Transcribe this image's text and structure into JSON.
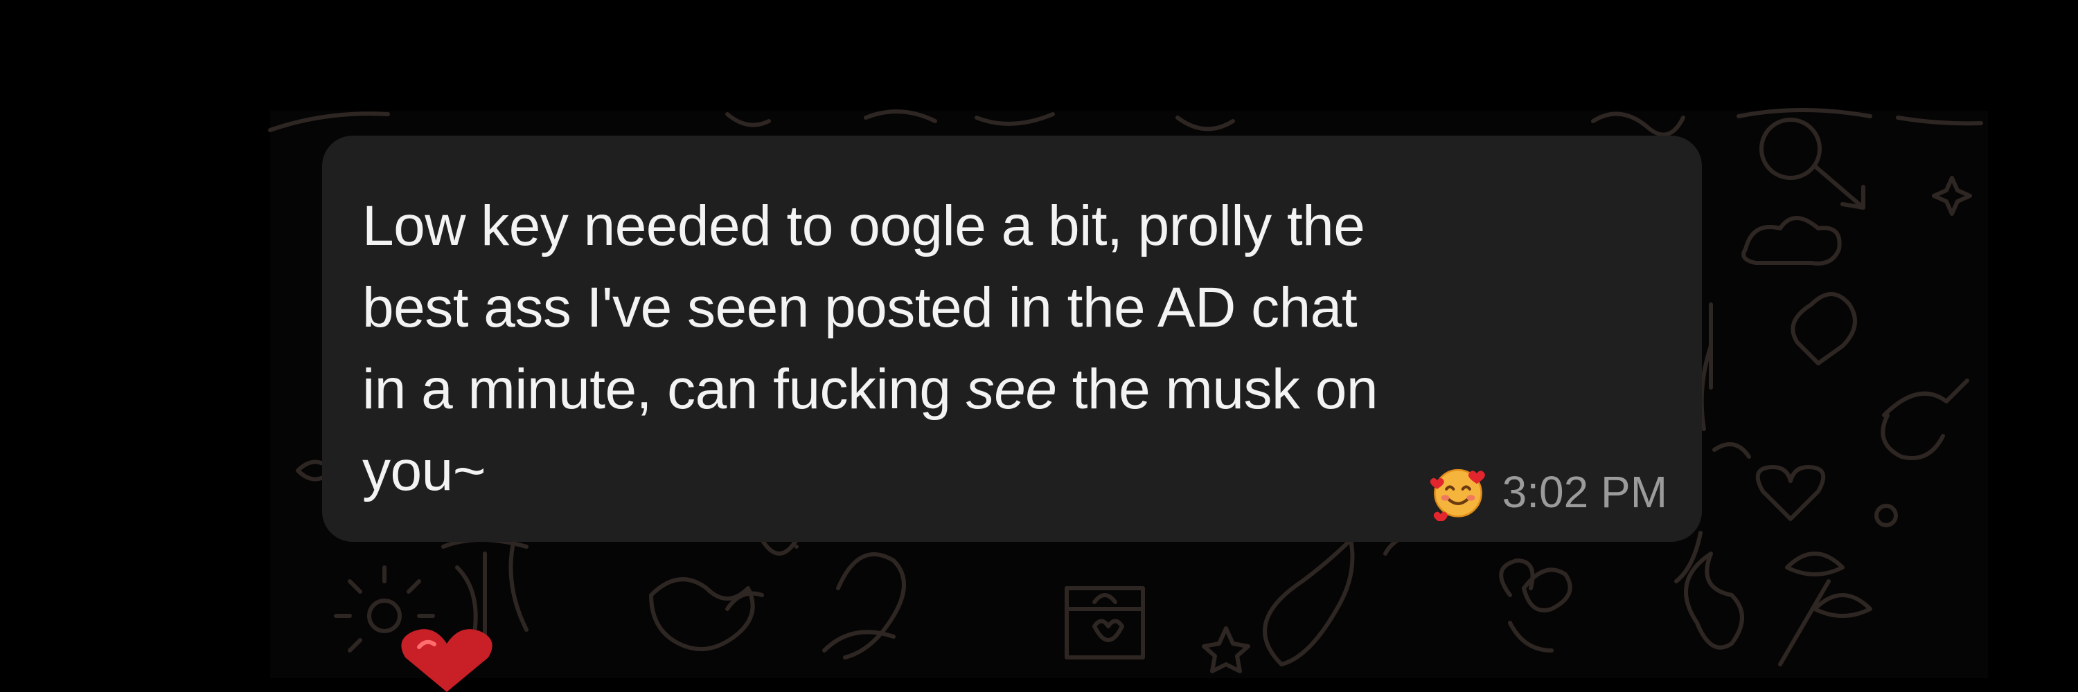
{
  "message": {
    "line1": "Low key needed to oogle a bit, prolly the",
    "line2": "best ass I've seen posted in the AD chat",
    "line3_before": "in a minute, can fucking ",
    "line3_emphasis": "see",
    "line3_after": " the musk on",
    "line4": "you~",
    "timestamp": "3:02 PM",
    "reaction_icon": "smiling-face-with-hearts-icon"
  },
  "colors": {
    "background": "#000000",
    "bubble": "#1f1f1f",
    "text": "#f3f3f3",
    "timestamp": "#9b9b9b",
    "doodle": "#2e2622"
  }
}
